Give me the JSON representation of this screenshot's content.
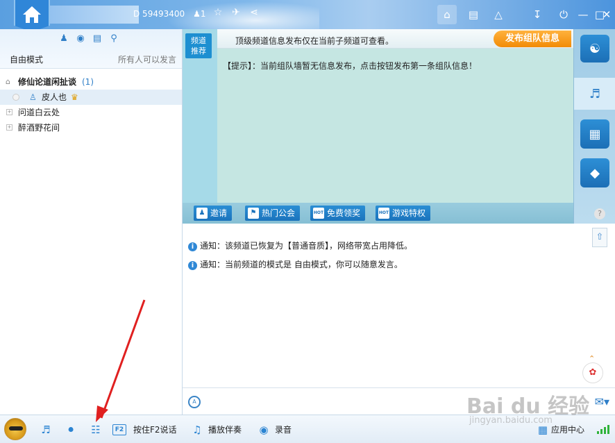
{
  "topbar": {
    "user_id": "D 59493400",
    "online_count": "1",
    "colors": {
      "bar": "#5a9fe0",
      "logo": "#2f86d8"
    }
  },
  "left_panel": {
    "mode_label": "自由模式",
    "mode_hint": "所有人可以发言",
    "tree": {
      "root_name": "修仙论道闲扯谈",
      "root_count": "(1)",
      "member": "皮人也",
      "subchannels": [
        "问道白云处",
        "醉酒野花间"
      ]
    }
  },
  "board": {
    "channel_tab": [
      "频道",
      "推荐"
    ],
    "header": "顶级频道信息发布仅在当前子频道可查看。",
    "publish_button": "发布组队信息",
    "tip_tag": "【提示】",
    "tip_text": "：当前组队墙暂无信息发布，点击按钮发布第一条组队信息！"
  },
  "tabbar": {
    "items": [
      {
        "label": "邀请",
        "icon": "invite-icon"
      },
      {
        "label": "热门公会",
        "icon": "guild-icon"
      },
      {
        "label": "免费领奖",
        "icon": "gift-icon"
      },
      {
        "label": "游戏特权",
        "icon": "privilege-icon"
      }
    ],
    "hot_badge": "HOT"
  },
  "chat": {
    "messages": [
      "通知：该频道已恢复为【普通音质】，网络带宽占用降低。",
      "通知：当前频道的模式是 自由模式，你可以随意发言。"
    ]
  },
  "bottombar": {
    "f2_key": "F2",
    "f2_label": "按住F2说话",
    "accompany_label": "播放伴奏",
    "record_label": "录音",
    "app_center_label": "应用中心"
  },
  "watermark": {
    "text": "Bai du 经验",
    "sub": "jingyan.baidu.com"
  }
}
